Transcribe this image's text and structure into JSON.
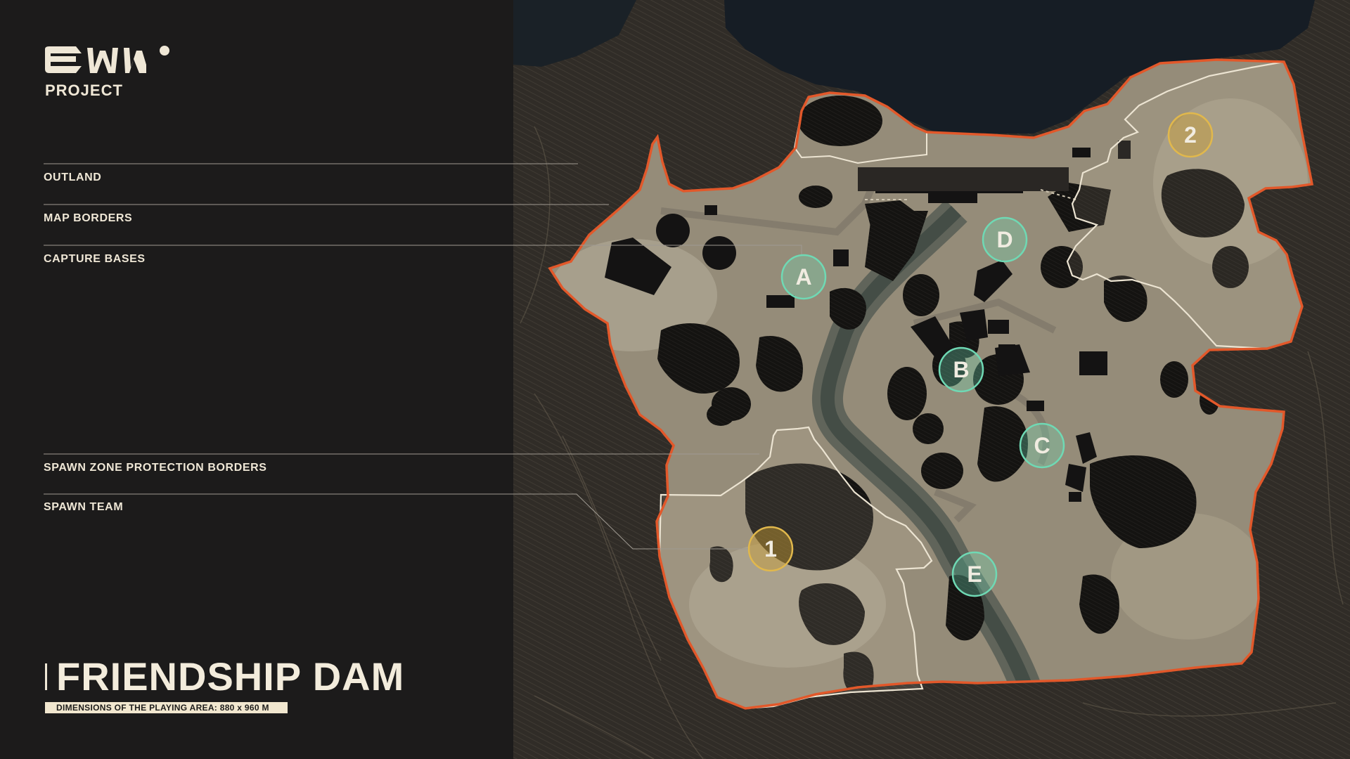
{
  "logo": {
    "caption": "PROJECT"
  },
  "legend": [
    {
      "label": "OUTLAND"
    },
    {
      "label": "MAP BORDERS"
    },
    {
      "label": "CAPTURE BASES"
    },
    {
      "label": "SPAWN ZONE PROTECTION BORDERS"
    },
    {
      "label": "SPAWN TEAM"
    }
  ],
  "map": {
    "title": "FRIENDSHIP DAM",
    "dimensions": "DIMENSIONS OF THE PLAYING AREA: 880 x 960 M"
  },
  "capture_bases": [
    {
      "label": "A"
    },
    {
      "label": "B"
    },
    {
      "label": "C"
    },
    {
      "label": "D"
    },
    {
      "label": "E"
    }
  ],
  "spawn_teams": [
    {
      "label": "1"
    },
    {
      "label": "2"
    }
  ],
  "colors": {
    "map_border": "#e2582a",
    "spawn_border": "#ece4d2",
    "capture_base": "#6fd9b4",
    "spawn_team": "#e1b84c",
    "terrain": "#8d8473",
    "water": "#161e27"
  }
}
